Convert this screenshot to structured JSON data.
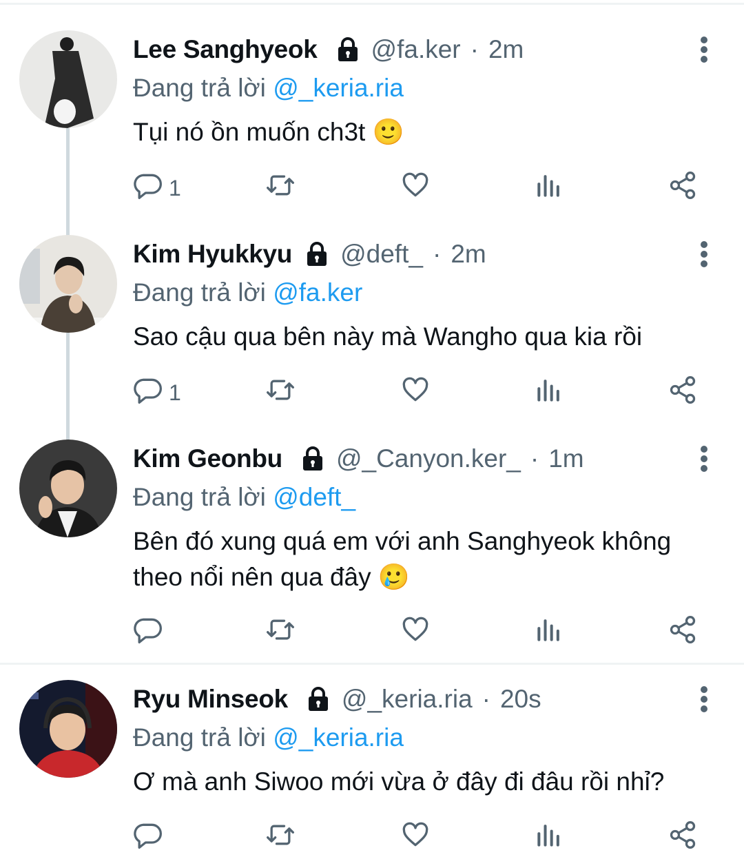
{
  "ui": {
    "replying_label": "Đang trả lời",
    "dot": "·"
  },
  "tweets": [
    {
      "name": "Lee Sanghyeok",
      "handle": "@fa.ker",
      "time": "2m",
      "reply_to": "@_keria.ria",
      "text": "Tụi nó ồn muốn ch3t 🙂",
      "reply_count": "1"
    },
    {
      "name": "Kim Hyukkyu",
      "handle": "@deft_",
      "time": "2m",
      "reply_to": "@fa.ker",
      "text": "Sao cậu qua bên này mà Wangho qua kia rồi",
      "reply_count": "1"
    },
    {
      "name": "Kim Geonbu",
      "handle": "@_Canyon.ker_",
      "time": "1m",
      "reply_to": "@deft_",
      "text": "Bên đó xung quá em với anh Sanghyeok không theo nổi nên qua đây 🥲",
      "reply_count": ""
    },
    {
      "name": "Ryu Minseok",
      "handle": "@_keria.ria",
      "time": "20s",
      "reply_to": "@_keria.ria",
      "text": "Ơ mà anh Siwoo mới vừa ở đây đi đâu rồi nhỉ?",
      "reply_count": ""
    }
  ],
  "icons": {
    "lock": "lock-icon",
    "more": "more-vertical-icon",
    "reply": "reply-icon",
    "retweet": "retweet-icon",
    "like": "heart-icon",
    "views": "views-icon",
    "share": "share-icon"
  },
  "colors": {
    "mention": "#1d9bf0",
    "secondary_text": "#536471",
    "thread_line": "#cfd9de"
  }
}
